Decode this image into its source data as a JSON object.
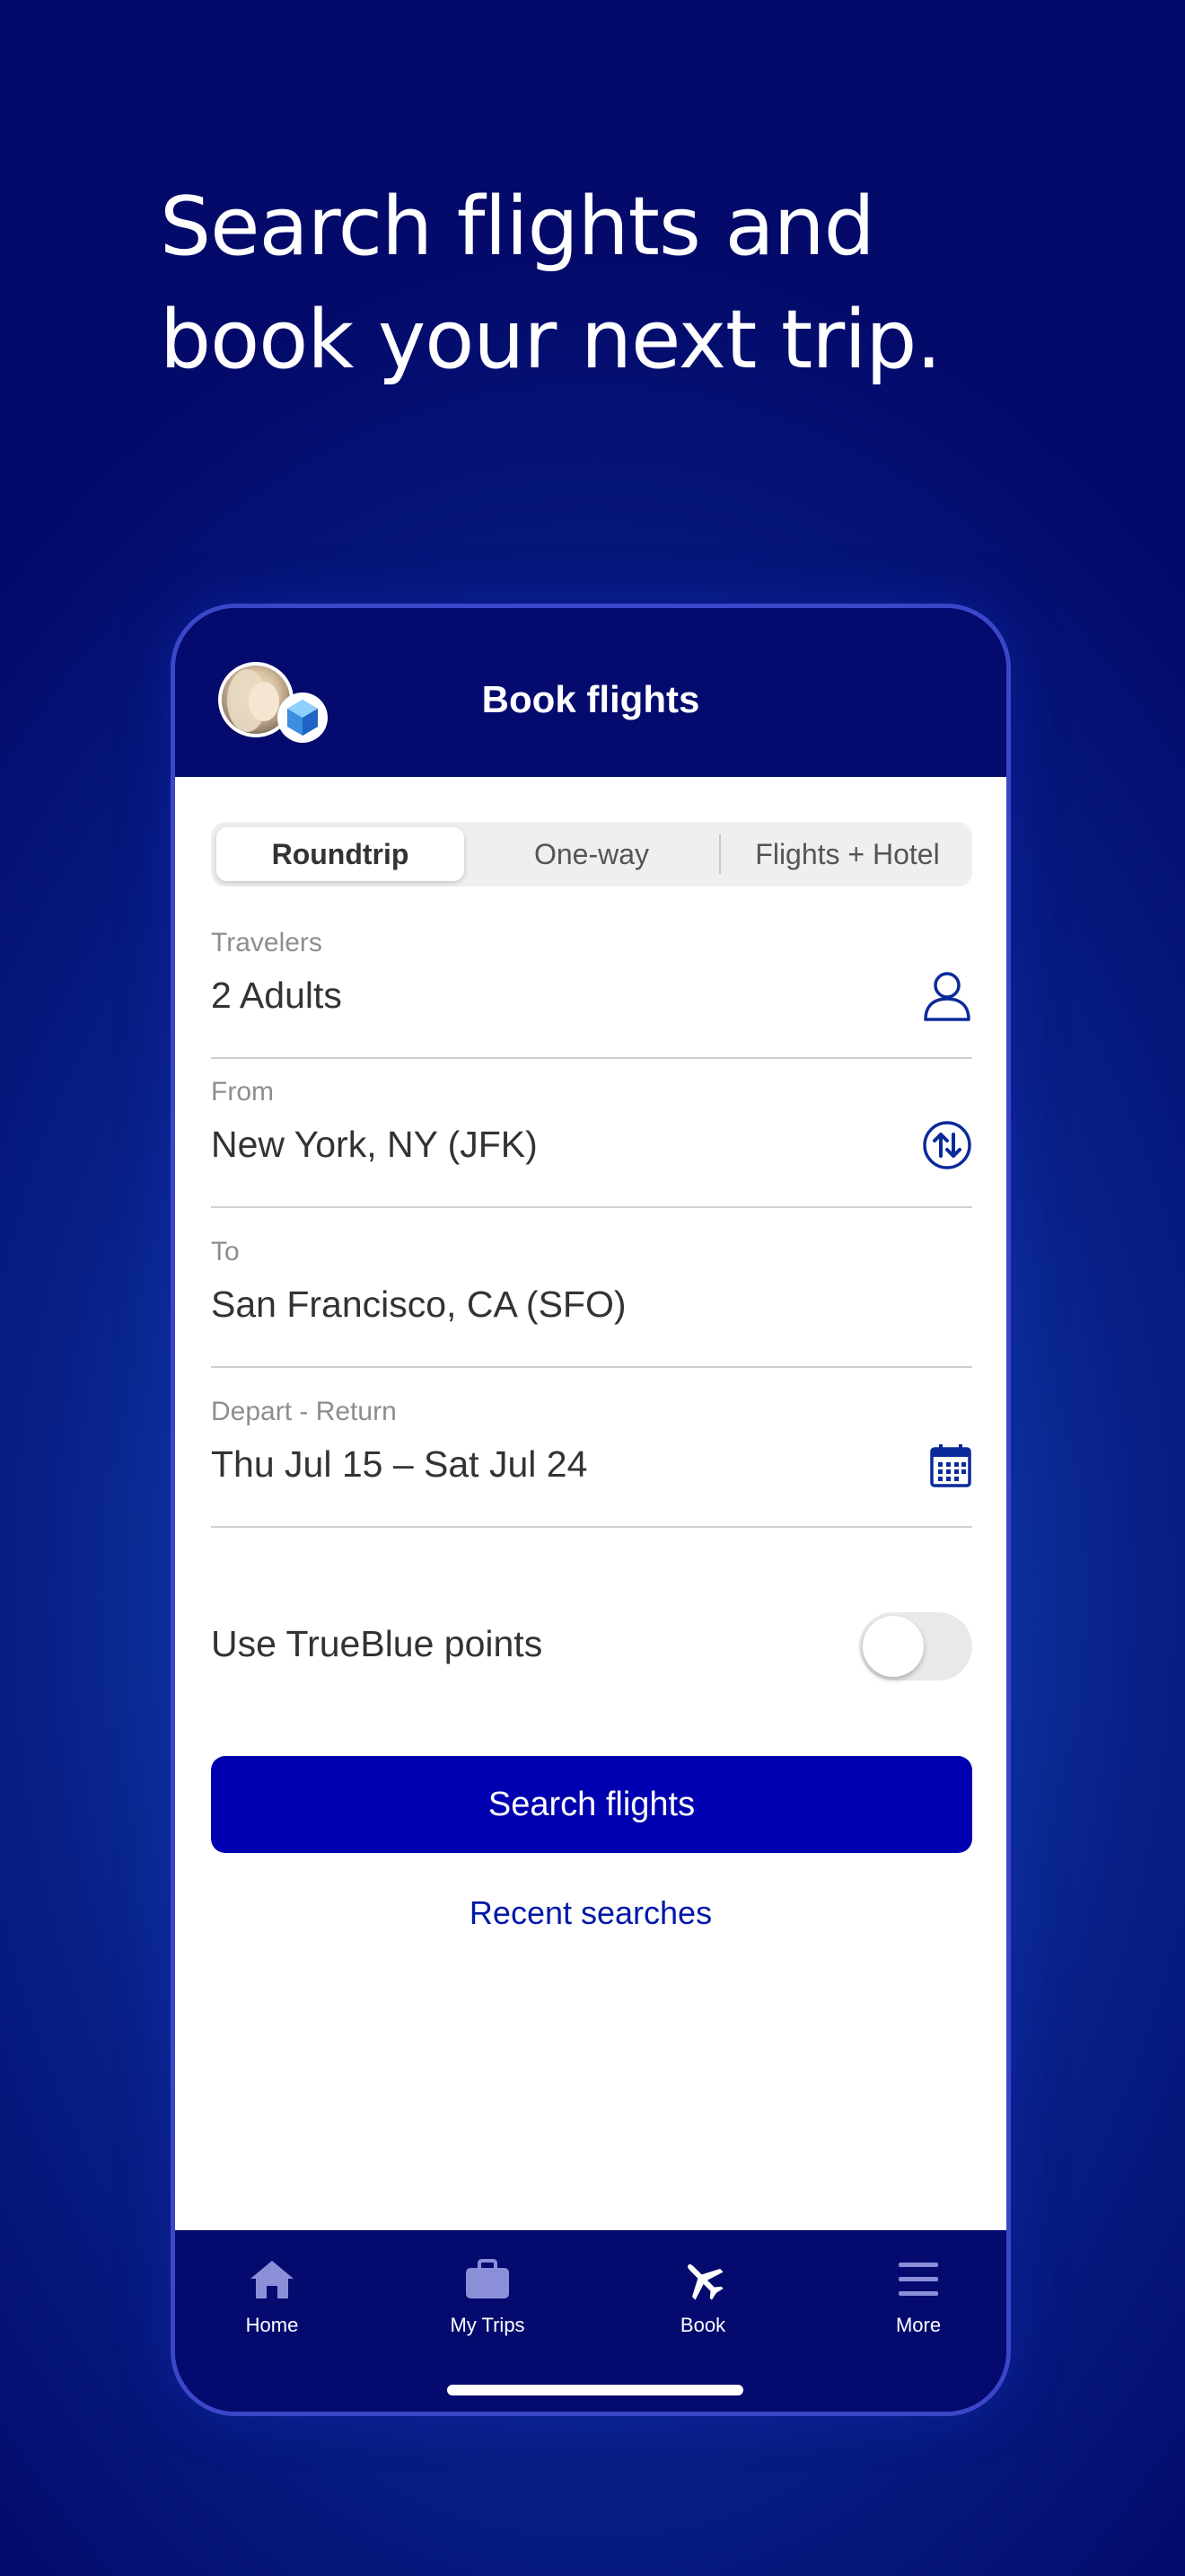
{
  "headline": {
    "line1": "Search flights and",
    "line2": "book your next trip."
  },
  "phone": {
    "title": "Book flights",
    "trip_types": [
      {
        "label": "Roundtrip",
        "selected": true
      },
      {
        "label": "One-way",
        "selected": false
      },
      {
        "label": "Flights + Hotel",
        "selected": false
      }
    ],
    "fields": {
      "travelers": {
        "label": "Travelers",
        "value": "2 Adults",
        "icon": "person-icon"
      },
      "from": {
        "label": "From",
        "value": "New York, NY (JFK)",
        "icon": "swap-icon"
      },
      "to": {
        "label": "To",
        "value": "San Francisco, CA (SFO)"
      },
      "dates": {
        "label": "Depart - Return",
        "value": "Thu Jul 15 – Sat Jul 24",
        "icon": "calendar-icon"
      }
    },
    "trueblue": {
      "label": "Use TrueBlue points",
      "enabled": false
    },
    "search_button": "Search flights",
    "recent_link": "Recent searches",
    "tabs": [
      {
        "label": "Home",
        "icon": "home-icon",
        "active": false
      },
      {
        "label": "My Trips",
        "icon": "briefcase-icon",
        "active": false
      },
      {
        "label": "Book",
        "icon": "airplane-icon",
        "active": true
      },
      {
        "label": "More",
        "icon": "menu-icon",
        "active": false
      }
    ]
  },
  "colors": {
    "brand_navy": "#040a6e",
    "button_blue": "#0000b0",
    "link_blue": "#0018a8",
    "icon_blue": "#0a2a9a"
  }
}
